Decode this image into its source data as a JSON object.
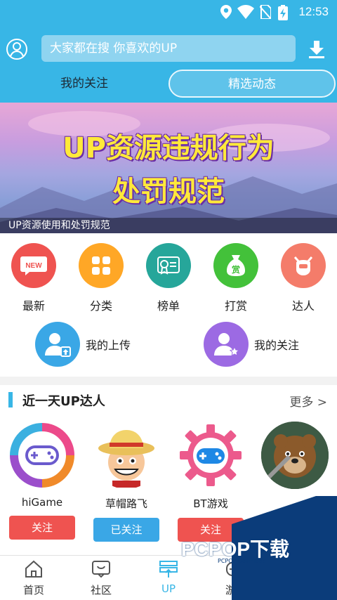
{
  "status_bar": {
    "time": "12:53"
  },
  "header": {
    "search_placeholder": "大家都在搜  你喜欢的UP",
    "tabs": [
      {
        "label": "我的关注",
        "active": false
      },
      {
        "label": "精选动态",
        "active": true
      }
    ]
  },
  "banner": {
    "line1": "UP资源违规行为",
    "line2": "处罚规范",
    "caption": "UP资源使用和处罚规范"
  },
  "quick_menu": [
    {
      "label": "最新",
      "icon": "new-icon",
      "color": "#ef5350"
    },
    {
      "label": "分类",
      "icon": "grid-icon",
      "color": "#ffa726"
    },
    {
      "label": "榜单",
      "icon": "ranking-icon",
      "color": "#26a69a"
    },
    {
      "label": "打赏",
      "icon": "reward-bag-icon",
      "color": "#43c13a"
    },
    {
      "label": "达人",
      "icon": "expert-icon",
      "color": "#f47c6a"
    }
  ],
  "big_menu": [
    {
      "label": "我的上传",
      "icon": "upload-user-icon",
      "color": "#3aa7e6"
    },
    {
      "label": "我的关注",
      "icon": "star-user-icon",
      "color": "#9c6ae3"
    }
  ],
  "section": {
    "title": "近一天UP达人",
    "more": "更多 >",
    "ups": [
      {
        "name": "hiGame",
        "button": "关注",
        "followed": false
      },
      {
        "name": "草帽路飞",
        "button": "已关注",
        "followed": true
      },
      {
        "name": "BT游戏",
        "button": "关注",
        "followed": false
      },
      {
        "name": "",
        "button": "",
        "followed": false
      }
    ]
  },
  "nav": [
    {
      "label": "首页",
      "icon": "home-icon",
      "active": false
    },
    {
      "label": "社区",
      "icon": "community-icon",
      "active": false
    },
    {
      "label": "UP",
      "icon": "up-icon",
      "active": true
    },
    {
      "label": "游戏",
      "icon": "gamepad-icon",
      "active": false
    },
    {
      "label": "",
      "icon": "profile-icon",
      "active": false
    }
  ],
  "watermark": {
    "text": "PCPOP下载",
    "sub": "PCPOP Download"
  },
  "colors": {
    "primary": "#38b6e6",
    "follow": "#ef5350",
    "followed": "#3aa7e6"
  }
}
